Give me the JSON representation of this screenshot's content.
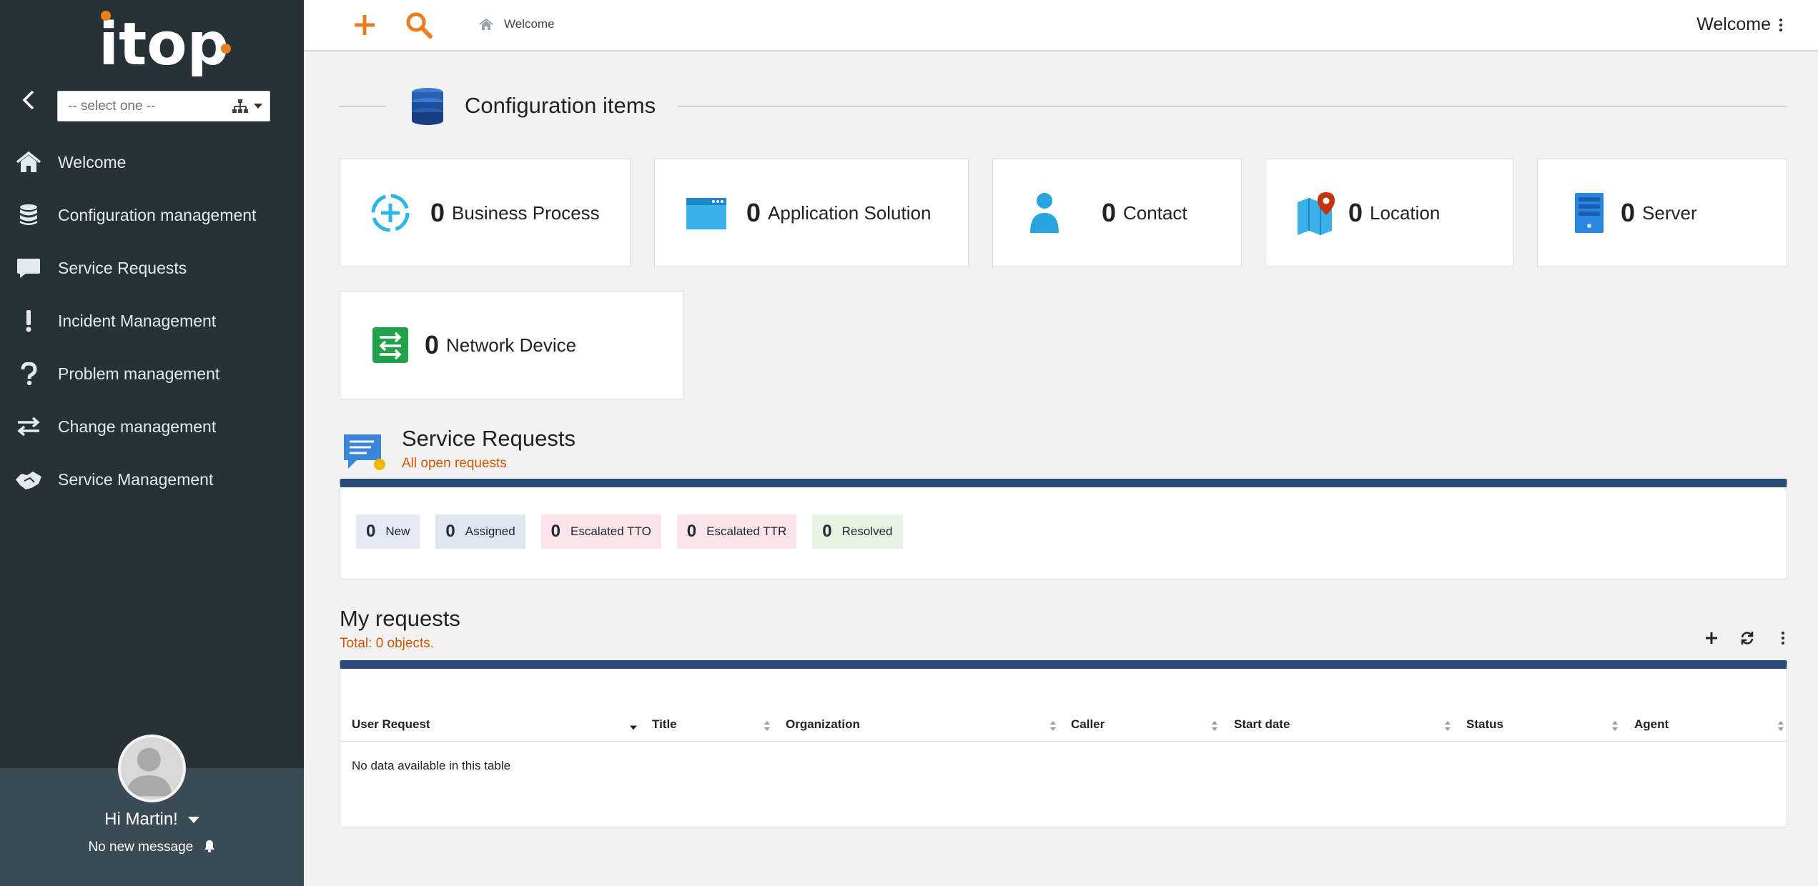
{
  "sidebar": {
    "org_select": {
      "value": "-- select one --"
    },
    "items": [
      {
        "id": "welcome",
        "label": "Welcome",
        "icon": "home-icon"
      },
      {
        "id": "configuration",
        "label": "Configuration management",
        "icon": "database-icon"
      },
      {
        "id": "service-requests",
        "label": "Service Requests",
        "icon": "comment-icon"
      },
      {
        "id": "incident",
        "label": "Incident Management",
        "icon": "exclamation-icon"
      },
      {
        "id": "problem",
        "label": "Problem management",
        "icon": "question-icon"
      },
      {
        "id": "change",
        "label": "Change management",
        "icon": "exchange-icon"
      },
      {
        "id": "service-mgmt",
        "label": "Service Management",
        "icon": "handshake-icon"
      }
    ],
    "user": {
      "greeting": "Hi Martin!",
      "messages": "No new message"
    }
  },
  "topbar": {
    "breadcrumb": "Welcome",
    "welcome_menu": "Welcome"
  },
  "config_items": {
    "title": "Configuration items",
    "cards": [
      {
        "count": "0",
        "label": "Business Process"
      },
      {
        "count": "0",
        "label": "Application Solution"
      },
      {
        "count": "0",
        "label": "Contact"
      },
      {
        "count": "0",
        "label": "Location"
      },
      {
        "count": "0",
        "label": "Server"
      },
      {
        "count": "0",
        "label": "Network Device"
      }
    ]
  },
  "service_requests": {
    "title": "Service Requests",
    "subtitle": "All open requests",
    "badges": [
      {
        "count": "0",
        "label": "New",
        "bg": "#e3eaf3"
      },
      {
        "count": "0",
        "label": "Assigned",
        "bg": "#dde6f0"
      },
      {
        "count": "0",
        "label": "Escalated TTO",
        "bg": "#fbe3ea"
      },
      {
        "count": "0",
        "label": "Escalated TTR",
        "bg": "#fbe3ea"
      },
      {
        "count": "0",
        "label": "Resolved",
        "bg": "#e7f3e2"
      }
    ]
  },
  "my_requests": {
    "title": "My requests",
    "total": "Total: 0 objects.",
    "columns": [
      "User Request",
      "Title",
      "Organization",
      "Caller",
      "Start date",
      "Status",
      "Agent"
    ],
    "empty": "No data available in this table"
  },
  "colors": {
    "accent": "#ea7d1e",
    "sidebar": "#263238",
    "panel_top": "#2b4b7a"
  }
}
